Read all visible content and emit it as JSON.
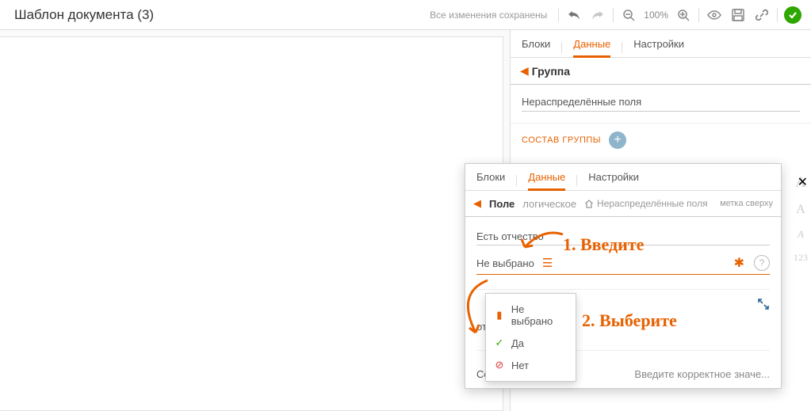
{
  "header": {
    "title": "Шаблон документа (3)",
    "saved": "Все изменения сохранены",
    "zoom": "100%"
  },
  "panel": {
    "tabs": {
      "blocks": "Блоки",
      "data": "Данные",
      "settings": "Настройки"
    },
    "group_title": "Группа",
    "group_name": "Нераспределённые поля",
    "group_compose": "СОСТАВ ГРУППЫ"
  },
  "popup": {
    "tabs": {
      "blocks": "Блоки",
      "data": "Данные",
      "settings": "Настройки"
    },
    "field_title": "Поле",
    "field_type": "логическое",
    "field_parent": "Нераспределённые поля",
    "label_pos": "метка сверху",
    "field_name": "Есть отчество",
    "select_value": "Не выбрано",
    "info_sub": "отчество",
    "msg_label": "Сообщение",
    "msg_placeholder": "Введите корректное значе..."
  },
  "dropdown": {
    "none": "Не выбрано",
    "yes": "Да",
    "no": "Нет"
  },
  "annotations": {
    "a1": "1. Введите",
    "a2": "2. Выберите"
  }
}
